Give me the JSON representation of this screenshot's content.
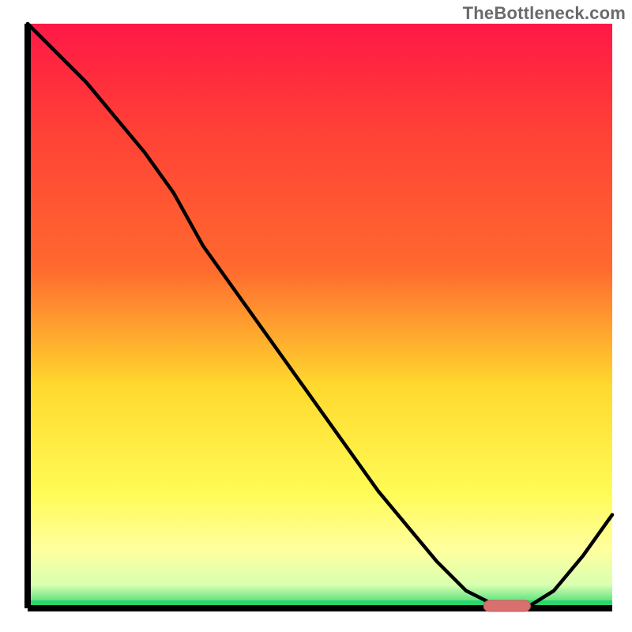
{
  "watermark": "TheBottleneck.com",
  "colors": {
    "axis": "#000000",
    "curve": "#000000",
    "marker_fill": "#d9706f",
    "gradient_top": "#ff1846",
    "gradient_mid1": "#ff6a2e",
    "gradient_mid2": "#ffd92e",
    "gradient_soft": "#ffff9e",
    "gradient_base": "#2bd66a"
  },
  "chart_data": {
    "type": "line",
    "title": "",
    "xlabel": "",
    "ylabel": "",
    "xlim": [
      0,
      100
    ],
    "ylim": [
      0,
      100
    ],
    "x": [
      0,
      5,
      10,
      15,
      20,
      25,
      30,
      35,
      40,
      45,
      50,
      55,
      60,
      65,
      70,
      75,
      80,
      82,
      84,
      86,
      90,
      95,
      100
    ],
    "y": [
      100,
      95,
      90,
      84,
      78,
      71,
      62,
      55,
      48,
      41,
      34,
      27,
      20,
      14,
      8,
      3,
      0.5,
      0,
      0,
      0.5,
      3,
      9,
      16
    ],
    "optimum_zone": {
      "x_start": 78,
      "x_end": 86,
      "y": 0
    },
    "notes": "y read as fraction of plot height above x-axis; gradient background red→orange→yellow→pale→green top-to-bottom; thin green baseline band"
  }
}
